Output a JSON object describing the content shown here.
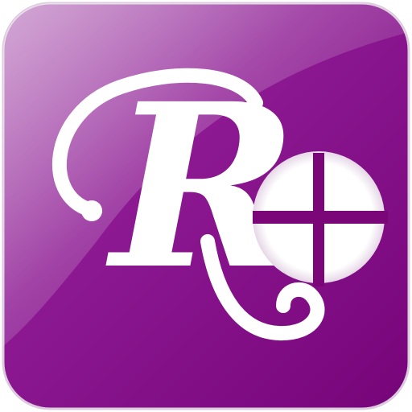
{
  "icon": {
    "logo_letter": "R",
    "plus_symbol": "+"
  },
  "colors": {
    "tile_purple": "#7c0780",
    "tile_purple_light": "#a44aa8",
    "tile_border": "#d8c6da",
    "letter_white": "#ffffff",
    "badge_white": "#ffffff",
    "badge_cross": "#7a0678"
  }
}
